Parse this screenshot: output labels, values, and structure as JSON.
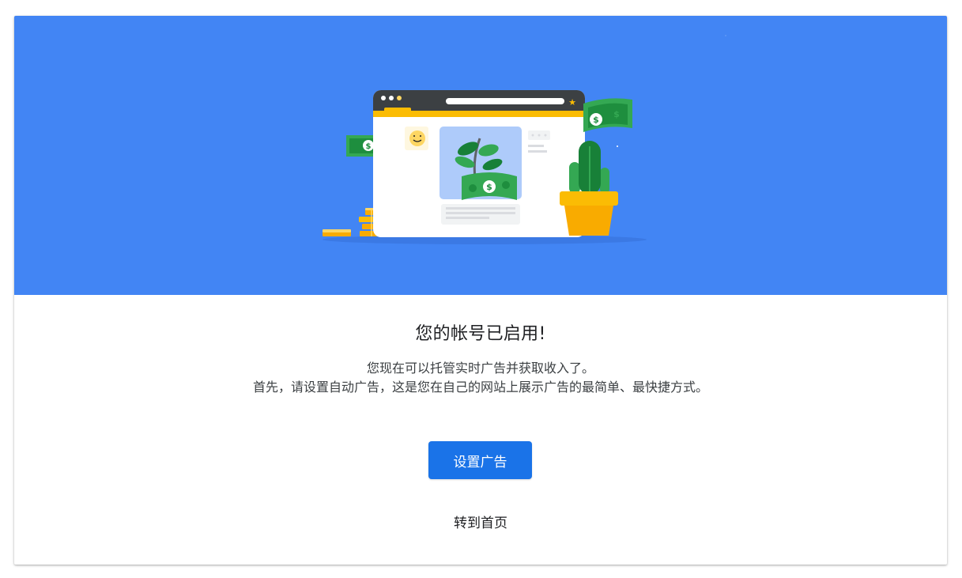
{
  "hero": {
    "illustration": "website-with-plant-money-cactus-coins",
    "colors": {
      "background": "#4285f4",
      "money": "#34a853",
      "accent": "#fbbc04"
    }
  },
  "content": {
    "title": "您的帐号已启用!",
    "description_line1": "您现在可以托管实时广告并获取收入了。",
    "description_line2": "首先，请设置自动广告，这是您在自己的网站上展示广告的最简单、最快捷方式。"
  },
  "actions": {
    "setup_ads_label": "设置广告",
    "go_home_label": "转到首页"
  },
  "theme": {
    "primary": "#1a73e8"
  }
}
